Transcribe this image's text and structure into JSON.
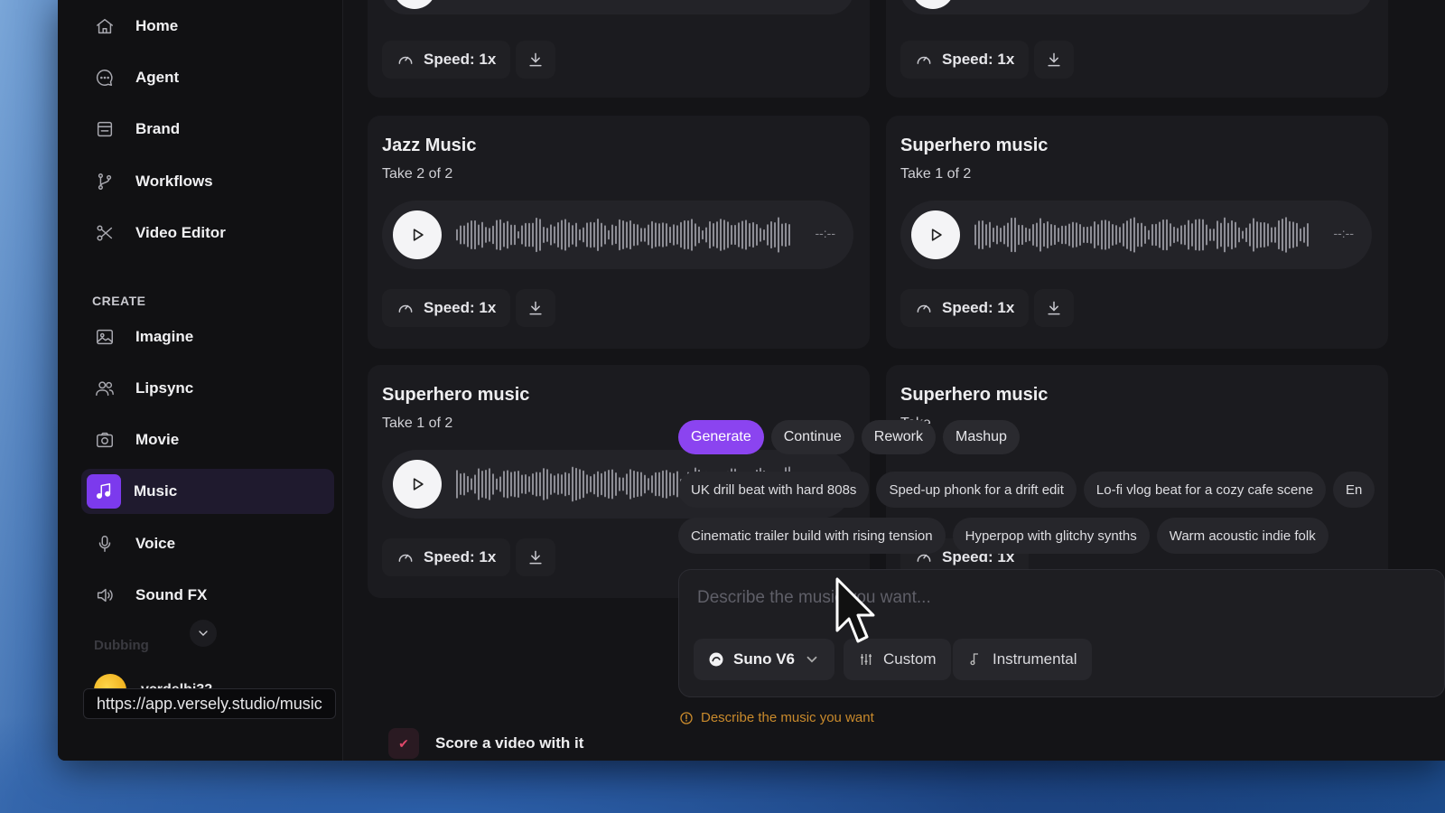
{
  "browser": {
    "status_url": "https://app.versely.studio/music"
  },
  "sidebar": {
    "items_top": [
      {
        "label": "Home",
        "icon": "home-icon"
      },
      {
        "label": "Agent",
        "icon": "chat-icon"
      },
      {
        "label": "Brand",
        "icon": "store-icon"
      },
      {
        "label": "Workflows",
        "icon": "branch-icon"
      },
      {
        "label": "Video Editor",
        "icon": "scissors-icon"
      }
    ],
    "section_label": "CREATE",
    "items_create": [
      {
        "label": "Imagine",
        "icon": "image-icon"
      },
      {
        "label": "Lipsync",
        "icon": "users-icon"
      },
      {
        "label": "Movie",
        "icon": "camera-icon"
      },
      {
        "label": "Music",
        "icon": "music-note-icon",
        "active": true
      },
      {
        "label": "Voice",
        "icon": "microphone-icon"
      },
      {
        "label": "Sound FX",
        "icon": "speaker-icon"
      }
    ],
    "faded_item": "Dubbing",
    "user": {
      "name": "vcrdelhi32"
    }
  },
  "cards": [
    {
      "title": "",
      "take": "",
      "speed_label": "Speed: 1x",
      "time": ""
    },
    {
      "title": "",
      "take": "",
      "speed_label": "Speed: 1x",
      "time": ""
    },
    {
      "title": "Jazz Music",
      "take": "Take 2 of 2",
      "speed_label": "Speed: 1x",
      "time": "--:--"
    },
    {
      "title": "Superhero music",
      "take": "Take 1 of 2",
      "speed_label": "Speed: 1x",
      "time": "--:--"
    },
    {
      "title": "Superhero music",
      "take": "Take 1 of 2",
      "speed_label": "Speed: 1x",
      "time": ""
    },
    {
      "title": "Superhero music",
      "take": "Take",
      "speed_label": "Speed: 1x",
      "time": ""
    }
  ],
  "composer": {
    "tabs": [
      "Generate",
      "Continue",
      "Rework",
      "Mashup"
    ],
    "active_tab": "Generate",
    "suggestions_row1": [
      "UK drill beat with hard 808s",
      "Sped-up phonk for a drift edit",
      "Lo-fi vlog beat for a cozy cafe scene",
      "En"
    ],
    "suggestions_row2": [
      "Cinematic trailer build with rising tension",
      "Hyperpop with glitchy synths",
      "Warm acoustic indie folk"
    ],
    "placeholder": "Describe the music you want...",
    "model_label": "Suno V6",
    "custom_label": "Custom",
    "instrumental_label": "Instrumental",
    "hint": "Describe the music you want"
  },
  "score_video_label": "Score a video with it",
  "colors": {
    "accent": "#7c3aed",
    "tab_active": "#8b44f0",
    "warning": "#c98a2c"
  }
}
